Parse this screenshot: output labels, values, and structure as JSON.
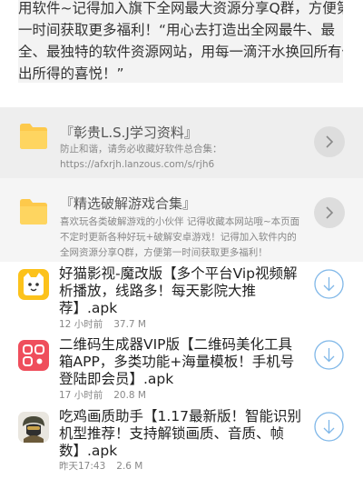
{
  "intro": {
    "text": "用软件~记得加入旗下全网最大资源分享Q群，方便第一时间获取更多福利！“用心去打造出全网最牛、最全、最独特的软件资源网站，用每一滴汗水换回所有付出所得的喜悦！”"
  },
  "folders": [
    {
      "title": "『彰贵L.S.J学习资料』",
      "desc": "防止和谐，请务必收藏好软件总合集：https://afxrjh.lanzous.com/s/rjh6"
    },
    {
      "title": "『精选破解游戏合集』",
      "desc": "喜欢玩各类破解游戏的小伙伴 记得收藏本网站哦~本页面不定时更新各种好玩+破解安卓游戏！记得加入软件内的全网资源分享Q群，方便第一时间获取更多福利！"
    }
  ],
  "apps": [
    {
      "title": "好猫影视-魔改版【多个平台Vip视频解析播放，线路多！每天影院大推荐】.apk",
      "time": "12 小时前",
      "size": "37.7 M",
      "icon": "cat-face-icon",
      "icon_color": "#fcc21b"
    },
    {
      "title": "二维码生成器VIP版【二维码美化工具箱APP，多类功能+海量模板！手机号登陆即会员】.apk",
      "time": "17 小时前",
      "size": "20.8 M",
      "icon": "qr-code-icon",
      "icon_color": "#ef4e5c"
    },
    {
      "title": "吃鸡画质助手【1.17最新版！智能识别机型推荐！支持解锁画质、音质、帧数】.apk",
      "time": "昨天17:43",
      "size": "2.6 M",
      "icon": "soldier-avatar-icon",
      "icon_color": "#3a3a3a"
    }
  ],
  "colors": {
    "folder_yellow": "#fdc94b",
    "download_blue": "#7fb7e8"
  }
}
